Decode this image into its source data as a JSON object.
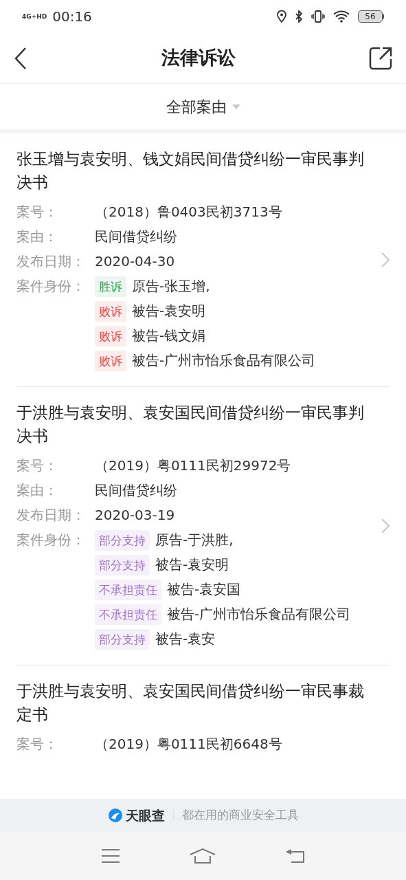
{
  "status_bar": {
    "network": "4G+HD",
    "time": "00:16",
    "battery": "56"
  },
  "header": {
    "title": "法律诉讼"
  },
  "filter": {
    "label": "全部案由"
  },
  "cases": [
    {
      "title": "张玉增与袁安明、钱文娟民间借贷纠纷一审民事判决书",
      "fields": [
        {
          "label": "案号：",
          "value": "（2018）鲁0403民初3713号"
        },
        {
          "label": "案由：",
          "value": "民间借贷纠纷"
        },
        {
          "label": "发布日期：",
          "value": "2020-04-30"
        }
      ],
      "identity_label": "案件身份：",
      "parties": [
        {
          "tag": "胜诉",
          "kind": "win",
          "name": "原告-张玉增,"
        },
        {
          "tag": "败诉",
          "kind": "lose",
          "name": "被告-袁安明"
        },
        {
          "tag": "败诉",
          "kind": "lose",
          "name": "被告-钱文娟"
        },
        {
          "tag": "败诉",
          "kind": "lose",
          "name": "被告-广州市怡乐食品有限公司"
        }
      ]
    },
    {
      "title": "于洪胜与袁安明、袁安国民间借贷纠纷一审民事判决书",
      "fields": [
        {
          "label": "案号：",
          "value": "（2019）粤0111民初29972号"
        },
        {
          "label": "案由：",
          "value": "民间借贷纠纷"
        },
        {
          "label": "发布日期：",
          "value": "2020-03-19"
        }
      ],
      "identity_label": "案件身份：",
      "parties": [
        {
          "tag": "部分支持",
          "kind": "neutral",
          "name": "原告-于洪胜,"
        },
        {
          "tag": "部分支持",
          "kind": "neutral",
          "name": "被告-袁安明"
        },
        {
          "tag": "不承担责任",
          "kind": "neutral",
          "name": "被告-袁安国"
        },
        {
          "tag": "不承担责任",
          "kind": "neutral",
          "name": "被告-广州市怡乐食品有限公司"
        },
        {
          "tag": "部分支持",
          "kind": "neutral",
          "name": "被告-袁安"
        }
      ]
    },
    {
      "title": "于洪胜与袁安明、袁安国民间借贷纠纷一审民事裁定书",
      "fields": [
        {
          "label": "案号：",
          "value": "（2019）粤0111民初6648号"
        }
      ]
    }
  ],
  "footer": {
    "brand": "天眼查",
    "slogan": "都在用的商业安全工具"
  }
}
